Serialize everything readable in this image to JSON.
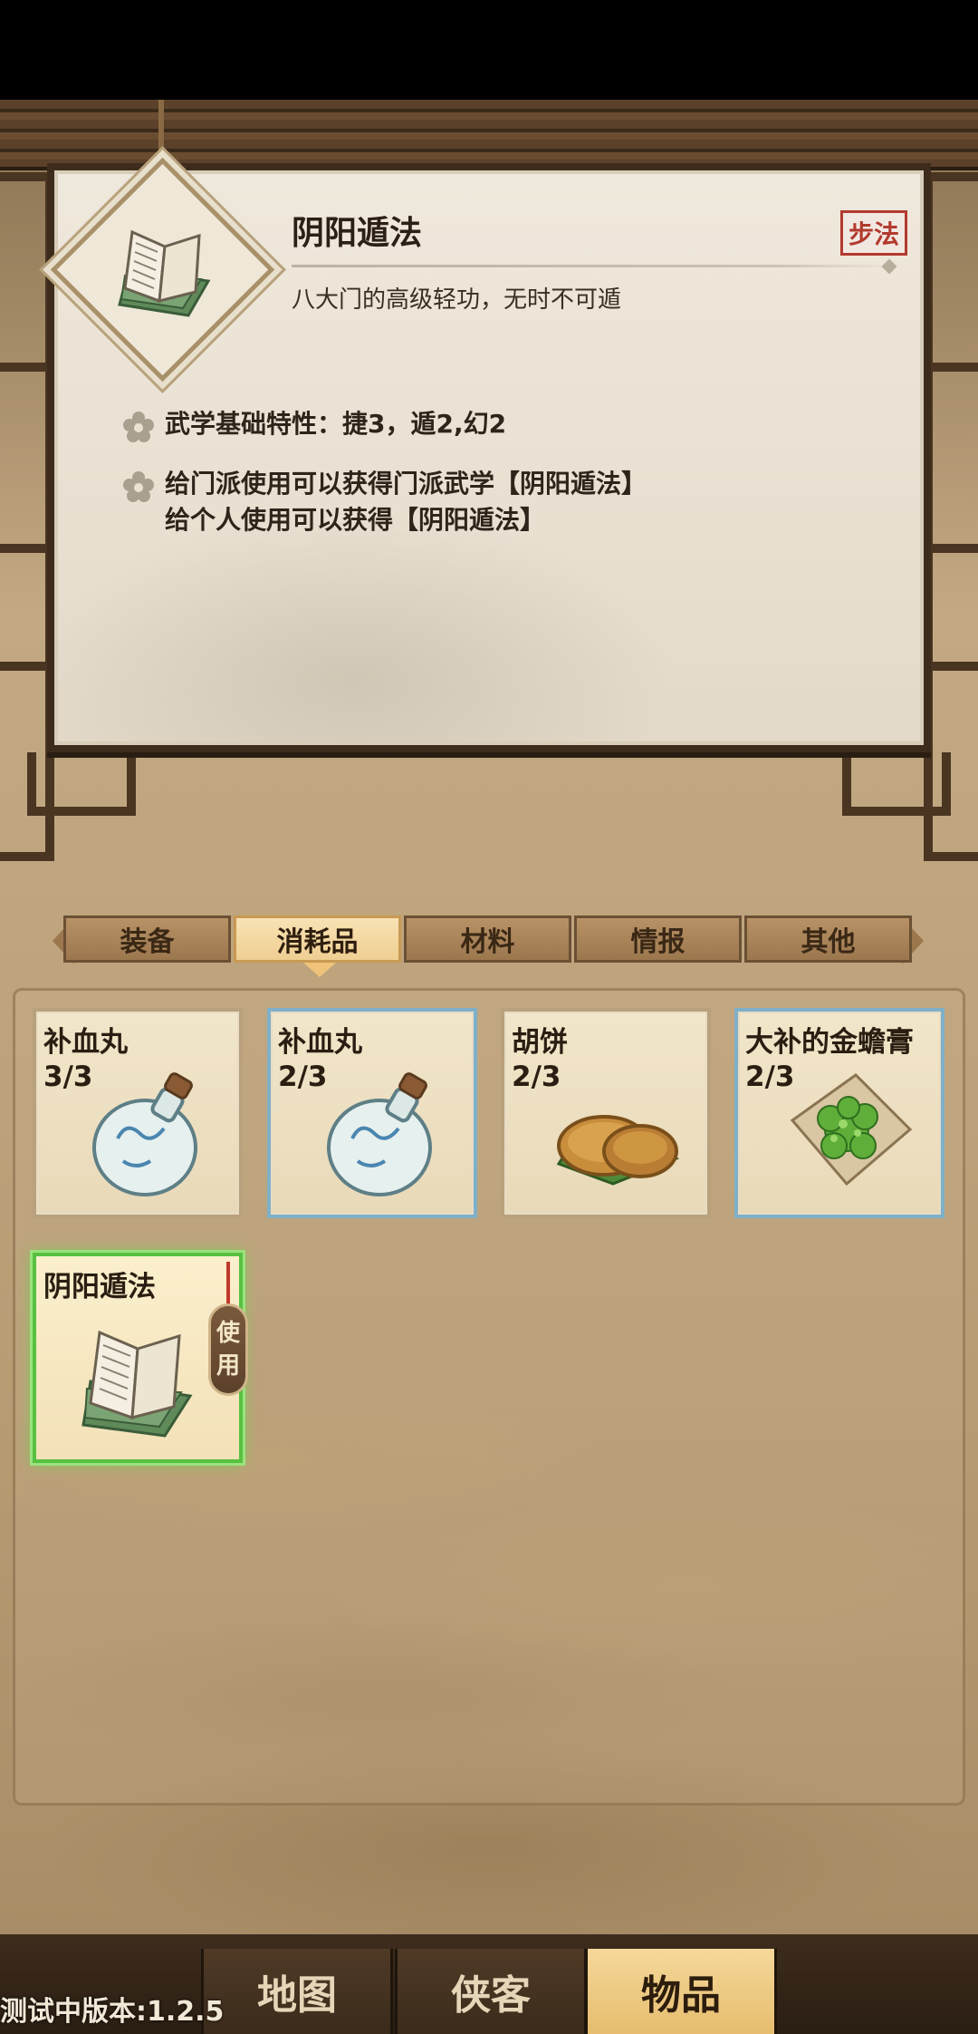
{
  "colors": {
    "panel_bg": "#e8e0d1",
    "frame_wood": "#3d2c1c",
    "badge_red": "#b23a2e",
    "tab_active": "#efcf92",
    "slot_blue_border": "#7fb0c8",
    "slot_selected_border": "#58c140",
    "nav_active": "#e6bd6e"
  },
  "detail": {
    "icon": "martial-manual-book-icon",
    "title": "阴阳遁法",
    "type_badge": "步法",
    "description": "八大门的高级轻功，无时不可遁",
    "properties": [
      {
        "icon": "flower-bullet-icon",
        "lines": [
          "武学基础特性：捷3，遁2,幻2"
        ]
      },
      {
        "icon": "flower-bullet-icon",
        "lines": [
          "给门派使用可以获得门派武学【阴阳遁法】",
          "给个人使用可以获得【阴阳遁法】"
        ]
      }
    ]
  },
  "tabs": [
    {
      "label": "装备",
      "active": false
    },
    {
      "label": "消耗品",
      "active": true
    },
    {
      "label": "材料",
      "active": false
    },
    {
      "label": "情报",
      "active": false
    },
    {
      "label": "其他",
      "active": false
    }
  ],
  "inventory": [
    {
      "name": "补血丸",
      "count": "3/3",
      "icon": "porcelain-bottle-icon",
      "frame": "plain",
      "selected": false
    },
    {
      "name": "补血丸",
      "count": "2/3",
      "icon": "porcelain-bottle-icon",
      "frame": "blue",
      "selected": false
    },
    {
      "name": "胡饼",
      "count": "2/3",
      "icon": "flatbread-icon",
      "frame": "plain",
      "selected": false
    },
    {
      "name": "大补的金蟾膏",
      "count": "2/3",
      "icon": "herbal-paste-icon",
      "frame": "blue",
      "selected": false
    },
    {
      "name": "阴阳遁法",
      "count": "",
      "icon": "martial-manual-book-icon",
      "frame": "selected",
      "selected": true
    }
  ],
  "use_button": {
    "label_top": "使",
    "label_bottom": "用"
  },
  "bottom_nav": [
    {
      "label": "地图",
      "active": false
    },
    {
      "label": "侠客",
      "active": false
    },
    {
      "label": "物品",
      "active": true
    }
  ],
  "version": "测试中版本:1.2.5"
}
